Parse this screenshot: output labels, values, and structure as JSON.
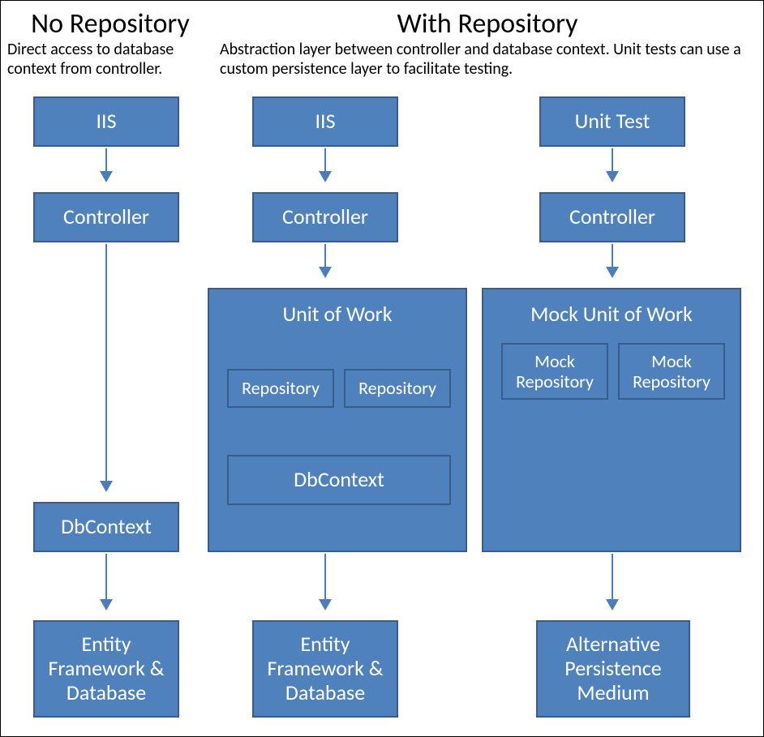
{
  "left": {
    "title": "No Repository",
    "desc": "Direct access to database context from controller.",
    "boxes": {
      "iis": "IIS",
      "controller": "Controller",
      "dbcontext": "DbContext",
      "ef": "Entity Framework & Database"
    }
  },
  "right": {
    "title": "With Repository",
    "desc": "Abstraction layer between controller and database context. Unit tests can use a custom persistence layer to facilitate testing.",
    "colA": {
      "iis": "IIS",
      "controller": "Controller",
      "uow": {
        "title": "Unit of Work",
        "repo1": "Repository",
        "repo2": "Repository",
        "dbcontext": "DbContext"
      },
      "ef": "Entity Framework & Database"
    },
    "colB": {
      "unit_test": "Unit Test",
      "controller": "Controller",
      "mock_uow": {
        "title": "Mock Unit of Work",
        "repo1": "Mock Repository",
        "repo2": "Mock Repository"
      },
      "alt": "Alternative Persistence Medium"
    }
  }
}
